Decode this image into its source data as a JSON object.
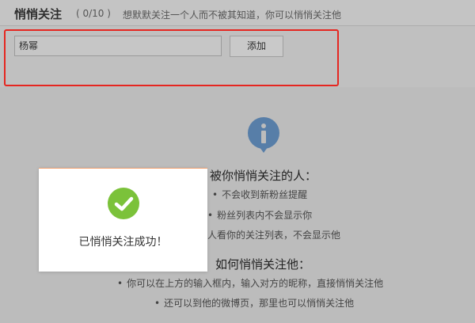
{
  "header": {
    "title": "悄悄关注",
    "count": "( 0/10 )",
    "description": "想默默关注一个人而不被其知道，你可以悄悄关注他"
  },
  "add_form": {
    "input_value": "杨幂",
    "add_label": "添加"
  },
  "info": {
    "icon": "info-icon",
    "section1_title": "被你悄悄关注的人：",
    "section1_items": [
      "不会收到新粉丝提醒",
      "粉丝列表内不会显示你",
      "人看你的关注列表，不会显示他"
    ],
    "section2_title": "如何悄悄关注他：",
    "section2_items": [
      "你可以在上方的输入框内，输入对方的昵称，直接悄悄关注他",
      "还可以到他的微博页，那里也可以悄悄关注他"
    ],
    "bullet_char": "•"
  },
  "toast": {
    "icon": "check-circle-icon",
    "message": "已悄悄关注成功！"
  },
  "colors": {
    "overlay": "#bcbcbc",
    "highlight": "#e52620",
    "success": "#7bc23a",
    "info": "#577ea8"
  }
}
